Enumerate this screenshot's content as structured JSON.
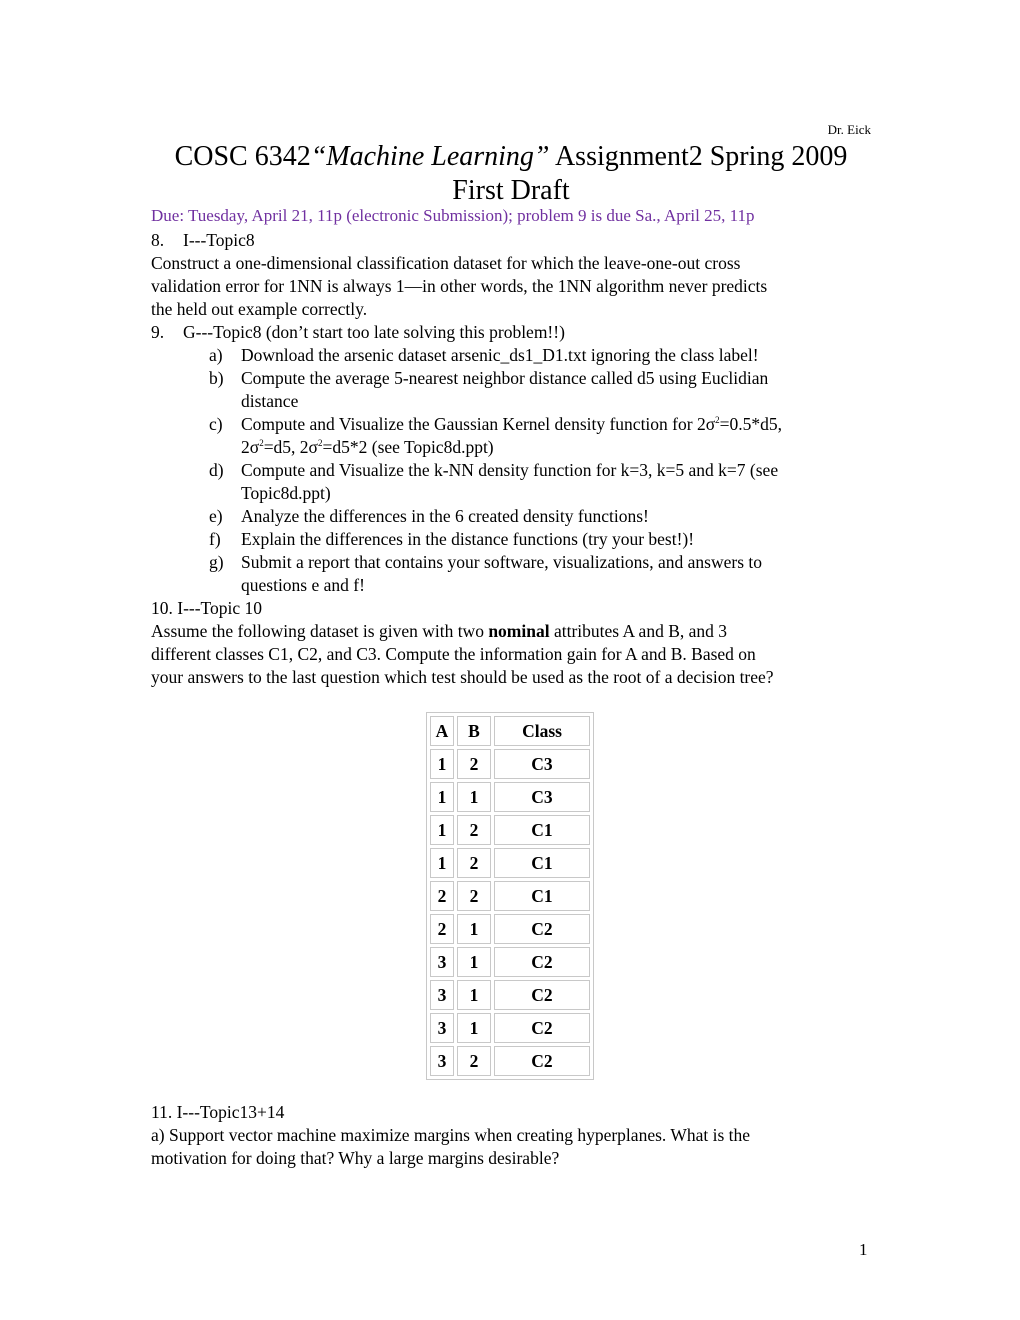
{
  "header": {
    "author": "Dr. Eick",
    "title_prefix": "COSC 6342",
    "title_italic": "“Machine Learning”",
    "title_suffix": " Assignment2 Spring 2009",
    "subtitle": "First Draft",
    "due_line": "Due: Tuesday, April 21, 11p (electronic Submission); problem 9 is due Sa., April 25, 11p",
    "due_color": "#7030A0"
  },
  "problem8": {
    "number": "8.",
    "heading": "I---Topic8",
    "text_lines": [
      "Construct a one-dimensional classification dataset for which the leave-one-out cross",
      "validation error for 1NN is always 1—in other words, the 1NN algorithm never predicts",
      "the held out example correctly."
    ]
  },
  "problem9": {
    "number": "9.",
    "heading": "G---Topic8 (don’t start too late solving this problem!!)",
    "items": [
      {
        "label": "a)",
        "lines": [
          "Download the arsenic dataset arsenic_ds1_D1.txt ignoring the class label!"
        ]
      },
      {
        "label": "b)",
        "lines": [
          "Compute the average 5-nearest neighbor distance called d5 using Euclidian",
          "distance"
        ]
      },
      {
        "label": "c)",
        "line1_a": "Compute and Visualize the Gaussian Kernel density function for 2σ",
        "line1_b": "=0.5*d5,",
        "line2_a": "2σ",
        "line2_b": "=d5, 2σ",
        "line2_c": "=d5*2 (see Topic8d.ppt)",
        "sup": "2"
      },
      {
        "label": "d)",
        "lines": [
          "Compute and Visualize the k-NN density function for k=3, k=5 and k=7 (see",
          "Topic8d.ppt)"
        ]
      },
      {
        "label": "e)",
        "lines": [
          "Analyze the differences in the 6 created density functions!"
        ]
      },
      {
        "label": "f)",
        "lines": [
          "Explain the differences in the distance functions (try your best!)!"
        ]
      },
      {
        "label": "g)",
        "lines": [
          "Submit a report that contains your software, visualizations, and answers to",
          "questions e and f!"
        ]
      }
    ]
  },
  "problem10": {
    "heading": "10. I---Topic 10",
    "text_a": "Assume the following dataset is given with two ",
    "text_bold": "nominal",
    "text_b": " attributes A and B, and 3",
    "text_lines": [
      "different classes C1, C2, and C3. Compute the information gain for A and B. Based on",
      "your answers to the last question which test should be used as the root of a decision tree?"
    ],
    "table": {
      "headers": [
        "A",
        "B",
        "Class"
      ],
      "rows": [
        [
          "1",
          "2",
          "C3"
        ],
        [
          "1",
          "1",
          "C3"
        ],
        [
          "1",
          "2",
          "C1"
        ],
        [
          "1",
          "2",
          "C1"
        ],
        [
          "2",
          "2",
          "C1"
        ],
        [
          "2",
          "1",
          "C2"
        ],
        [
          "3",
          "1",
          "C2"
        ],
        [
          "3",
          "1",
          "C2"
        ],
        [
          "3",
          "1",
          "C2"
        ],
        [
          "3",
          "2",
          "C2"
        ]
      ]
    }
  },
  "problem11": {
    "heading": "11. I---Topic13+14",
    "text_lines": [
      "a) Support vector machine maximize margins when creating hyperplanes. What is the",
      "motivation for doing that? Why a large margins desirable?"
    ]
  },
  "footer": {
    "page_number": "1"
  }
}
